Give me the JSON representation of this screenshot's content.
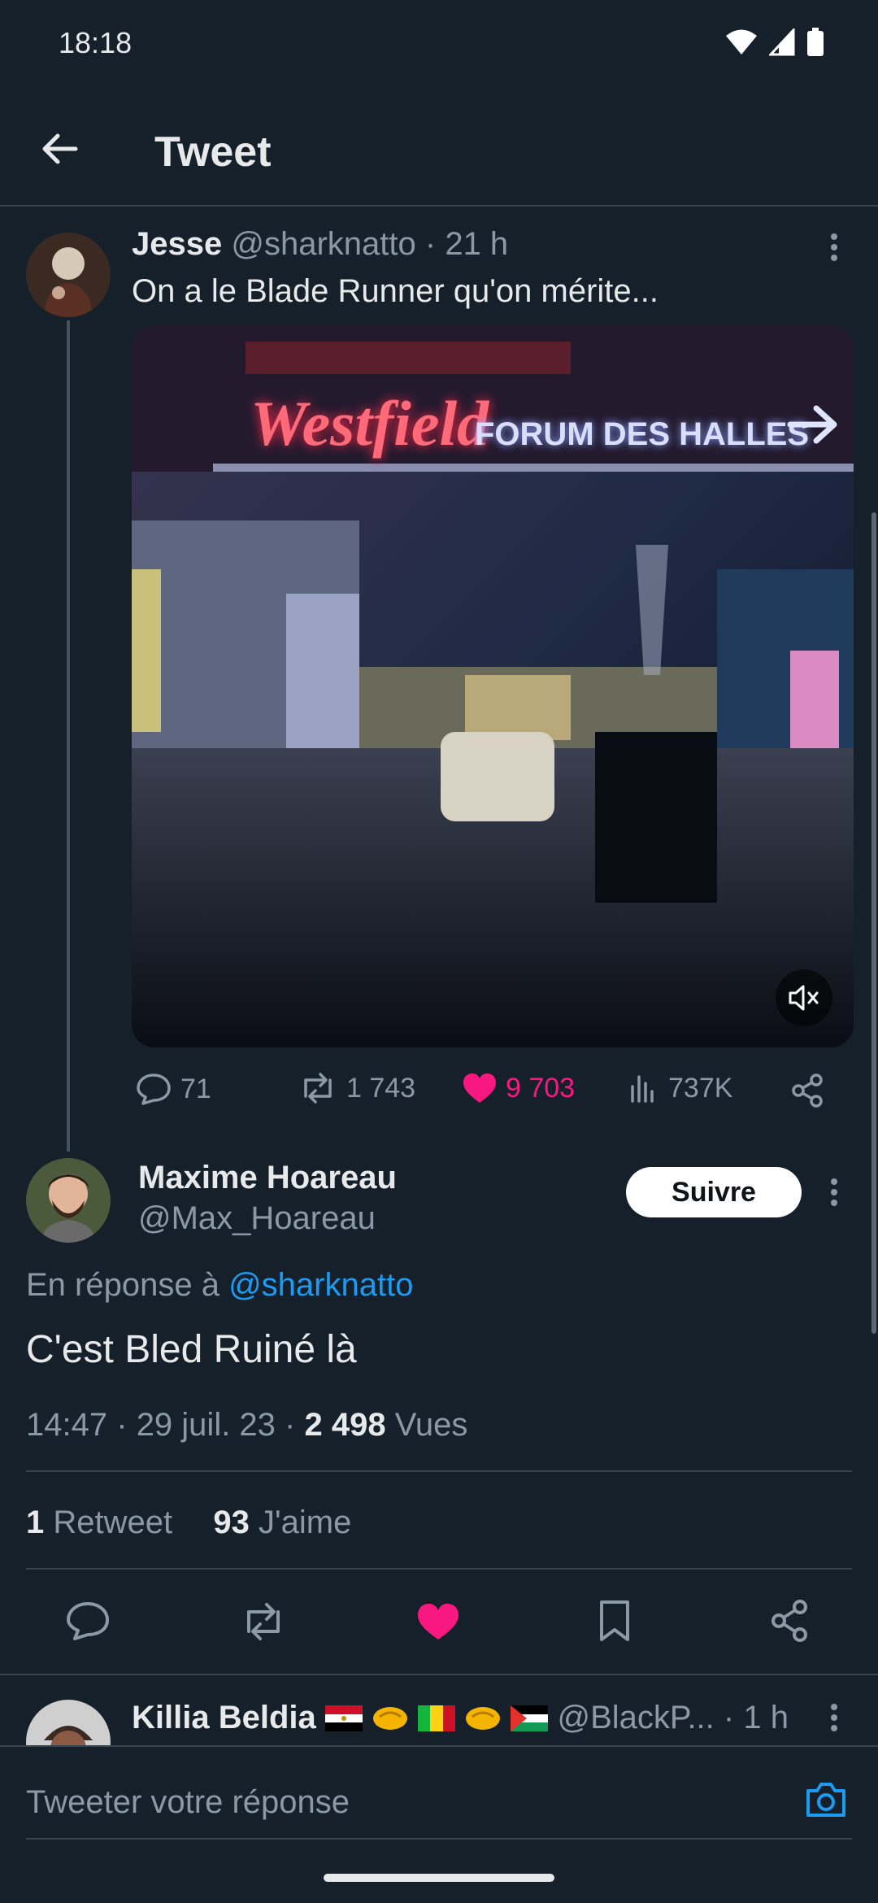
{
  "status_bar": {
    "time": "18:18"
  },
  "header": {
    "title": "Tweet"
  },
  "parent_tweet": {
    "author_name": "Jesse",
    "handle": "@sharknatto",
    "separator": "·",
    "age": "21 h",
    "text": "On a le Blade Runner qu'on mérite...",
    "media_sign_brand": "Westfield",
    "media_sign_location": "FORUM DES HALLES",
    "replies": "71",
    "retweets": "1 743",
    "likes": "9 703",
    "views": "737K"
  },
  "main_tweet": {
    "author_name": "Maxime Hoareau",
    "handle": "@Max_Hoareau",
    "follow_label": "Suivre",
    "reply_prefix": "En réponse à",
    "reply_to": "@sharknatto",
    "text": "C'est Bled Ruiné là",
    "time": "14:47",
    "date": "29 juil. 23",
    "separator": "·",
    "views_count": "2 498",
    "views_label": "Vues",
    "retweet_count": "1",
    "retweet_label": "Retweet",
    "like_count": "93",
    "like_label": "J'aime"
  },
  "next_reply": {
    "author_name": "Killia Beldia",
    "handle": "@BlackP...",
    "separator": "·",
    "age": "1 h"
  },
  "reply_bar": {
    "placeholder": "Tweeter votre réponse"
  },
  "colors": {
    "accent": "#1d9bf0",
    "like": "#f91880",
    "background": "#15202b"
  }
}
